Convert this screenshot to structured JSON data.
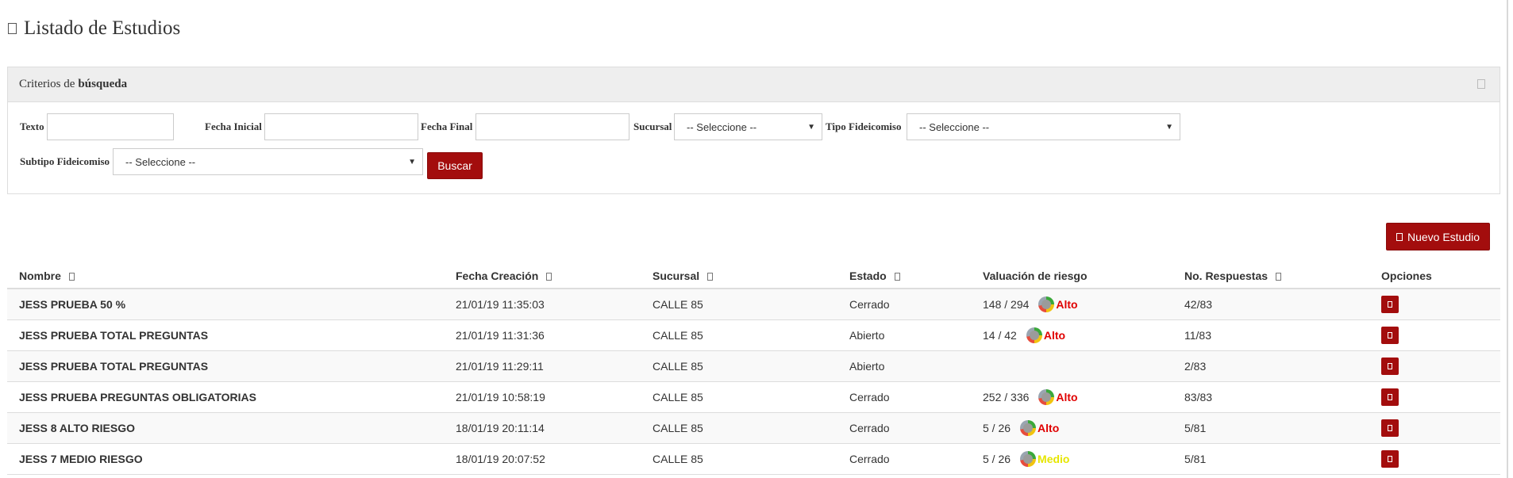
{
  "header": {
    "title": "Listado de Estudios"
  },
  "filters": {
    "panel_title_prefix": "Criterios de",
    "panel_title_bold": "búsqueda",
    "texto_label": "Texto",
    "texto_value": "",
    "fecha_inicial_label": "Fecha Inicial",
    "fecha_inicial_value": "",
    "fecha_final_label": "Fecha Final",
    "fecha_final_value": "",
    "sucursal_label": "Sucursal",
    "sucursal_selected": "-- Seleccione --",
    "tipo_label": "Tipo Fideicomiso",
    "tipo_selected": "-- Seleccione --",
    "subtipo_label": "Subtipo Fideicomiso",
    "subtipo_selected": "-- Seleccione --",
    "search_button": "Buscar"
  },
  "actions": {
    "new_study": "Nuevo Estudio"
  },
  "table": {
    "columns": [
      "Nombre",
      "Fecha Creación",
      "Sucursal",
      "Estado",
      "Valuación de riesgo",
      "No. Respuestas",
      "Opciones"
    ],
    "rows": [
      {
        "nombre": "JESS PRUEBA 50 %",
        "fecha": "21/01/19 11:35:03",
        "sucursal": "CALLE 85",
        "estado": "Cerrado",
        "valuacion": "148 / 294",
        "riesgo": "Alto",
        "respuestas": "42/83"
      },
      {
        "nombre": "JESS PRUEBA TOTAL PREGUNTAS",
        "fecha": "21/01/19 11:31:36",
        "sucursal": "CALLE 85",
        "estado": "Abierto",
        "valuacion": "14 / 42",
        "riesgo": "Alto",
        "respuestas": "11/83"
      },
      {
        "nombre": "JESS PRUEBA TOTAL PREGUNTAS",
        "fecha": "21/01/19 11:29:11",
        "sucursal": "CALLE 85",
        "estado": "Abierto",
        "valuacion": "",
        "riesgo": "",
        "respuestas": "2/83"
      },
      {
        "nombre": "JESS PRUEBA PREGUNTAS OBLIGATORIAS",
        "fecha": "21/01/19 10:58:19",
        "sucursal": "CALLE 85",
        "estado": "Cerrado",
        "valuacion": "252 / 336",
        "riesgo": "Alto",
        "respuestas": "83/83"
      },
      {
        "nombre": "JESS 8 ALTO RIESGO",
        "fecha": "18/01/19 20:11:14",
        "sucursal": "CALLE 85",
        "estado": "Cerrado",
        "valuacion": "5 / 26",
        "riesgo": "Alto",
        "respuestas": "5/81"
      },
      {
        "nombre": "JESS 7 MEDIO RIESGO",
        "fecha": "18/01/19 20:07:52",
        "sucursal": "CALLE 85",
        "estado": "Cerrado",
        "valuacion": "5 / 26",
        "riesgo": "Medio",
        "respuestas": "5/81"
      }
    ]
  },
  "colors": {
    "accent": "#a30d0d",
    "risk_high": "#e00000",
    "risk_medium": "#e6e600"
  },
  "icons": [
    "list-icon",
    "collapse-icon",
    "sort-icon",
    "gauge-icon",
    "edit-icon",
    "plus-icon"
  ]
}
